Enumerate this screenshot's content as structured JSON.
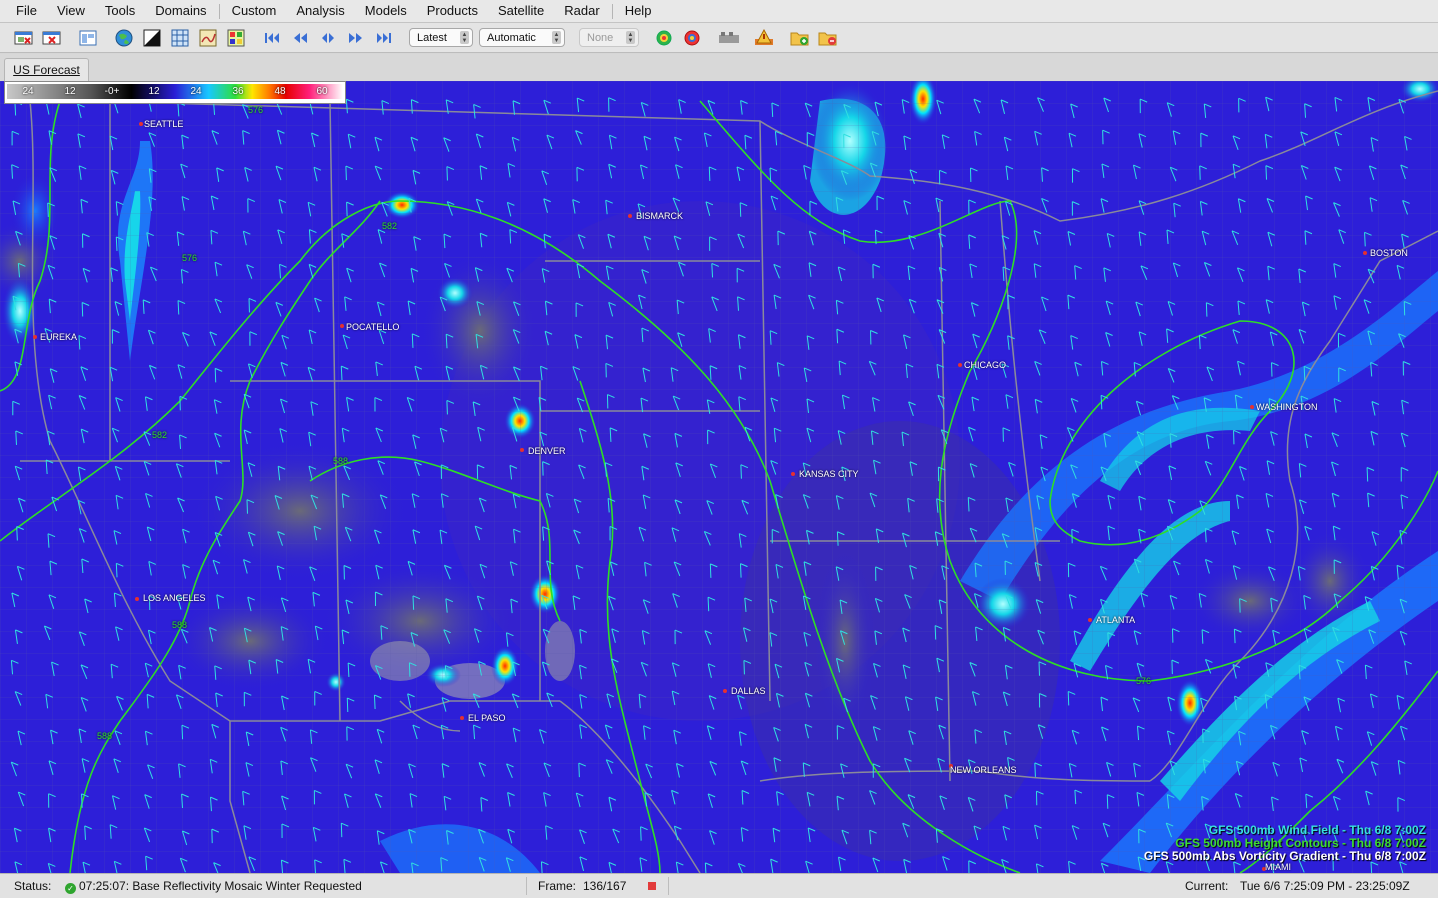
{
  "menu": [
    "File",
    "View",
    "Tools",
    "Domains",
    "Custom",
    "Analysis",
    "Models",
    "Products",
    "Satellite",
    "Radar",
    "Help"
  ],
  "toolbar": {
    "buttons": [
      "new-window-icon",
      "close-window-icon",
      "layout-icon",
      "globe-icon",
      "contrast-icon",
      "grid-icon",
      "topo-map-icon",
      "color-map-icon",
      "skip-first-icon",
      "step-back-icon",
      "play-loop-icon",
      "step-forward-icon",
      "skip-last-icon",
      "radar-site-icon",
      "radar-alert-icon",
      "satellite-dish-icon",
      "warning-map-icon",
      "add-folder-icon",
      "remove-folder-icon"
    ],
    "time_select": "Latest",
    "mode_select": "Automatic",
    "overlay_select": "None"
  },
  "tab": {
    "label": "US Forecast"
  },
  "legend": {
    "labels": [
      "24",
      "12",
      "-0+",
      "12",
      "24",
      "36",
      "48",
      "60"
    ]
  },
  "cities": [
    {
      "name": "SEATTLE"
    },
    {
      "name": "BISMARCK"
    },
    {
      "name": "BOSTON"
    },
    {
      "name": "EUREKA"
    },
    {
      "name": "POCATELLO"
    },
    {
      "name": "CHICAGO"
    },
    {
      "name": "WASHINGTON"
    },
    {
      "name": "DENVER"
    },
    {
      "name": "KANSAS CITY"
    },
    {
      "name": "LOS ANGELES"
    },
    {
      "name": "ATLANTA"
    },
    {
      "name": "DALLAS"
    },
    {
      "name": "EL PASO"
    },
    {
      "name": "NEW ORLEANS"
    },
    {
      "name": "MIAMI"
    }
  ],
  "contour_labels": [
    "576",
    "582",
    "588",
    "576",
    "582",
    "588",
    "576",
    "588"
  ],
  "overlays": [
    {
      "text": "GFS 500mb Wind Field - Thu 6/8 7:00Z",
      "color": "#37e0e0"
    },
    {
      "text": "GFS 500mb Height Contours - Thu 6/8 7:00Z",
      "color": "#3ddc2f"
    },
    {
      "text": "GFS 500mb Abs Vorticity Gradient - Thu 6/8 7:00Z",
      "color": "#ffffff"
    }
  ],
  "status": {
    "label": "Status:",
    "message": "07:25:07: Base Reflectivity Mosaic Winter Requested",
    "frame_label": "Frame:",
    "frame_value": "136/167",
    "current_label": "Current:",
    "current_value": "Tue 6/6 7:25:09 PM - 23:25:09Z"
  }
}
